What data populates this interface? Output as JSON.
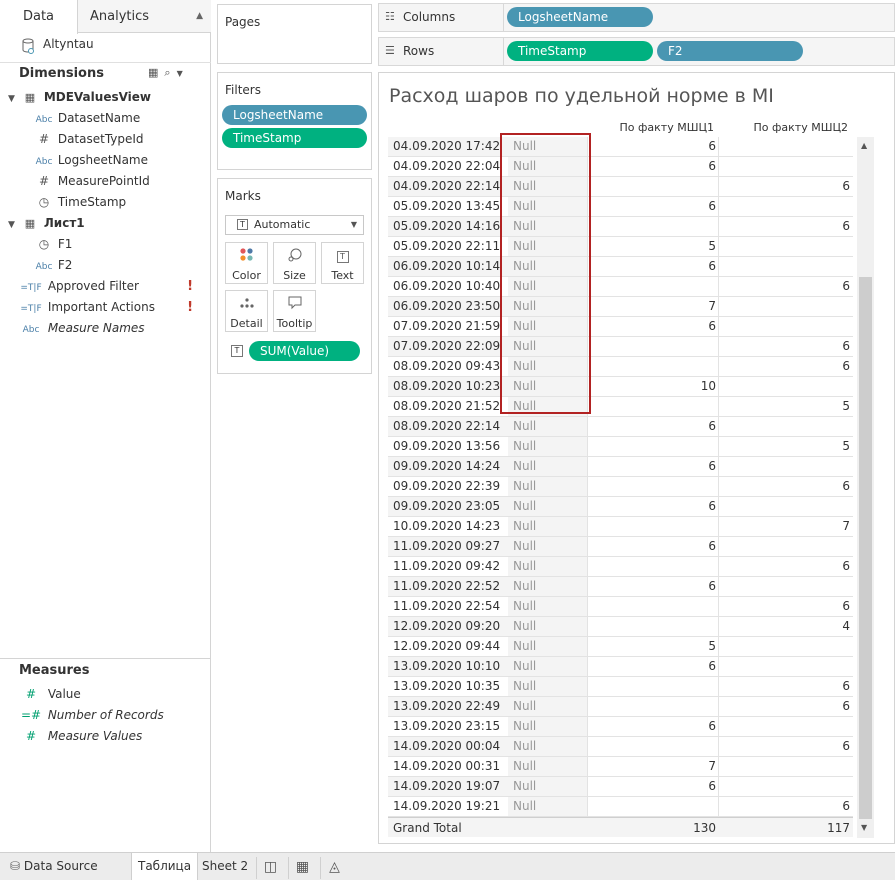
{
  "left_pane": {
    "tab_data": "Data",
    "tab_analytics": "Analytics",
    "datasource": "Altyntau",
    "dimensions_title": "Dimensions",
    "dimension_fields": [
      {
        "label": "MDEValuesView",
        "type": "table",
        "icon_text": "▦"
      },
      {
        "label": "DatasetName",
        "type": "string",
        "icon_text": "Abc"
      },
      {
        "label": "DatasetTypeId",
        "type": "number",
        "icon_text": "#"
      },
      {
        "label": "LogsheetName",
        "type": "string",
        "icon_text": "Abc"
      },
      {
        "label": "MeasurePointId",
        "type": "number",
        "icon_text": "#"
      },
      {
        "label": "TimeStamp",
        "type": "datetime",
        "icon_text": "◷"
      },
      {
        "label": "Лист1",
        "type": "table",
        "icon_text": "▦"
      },
      {
        "label": "F1",
        "type": "datetime",
        "icon_text": "◷"
      },
      {
        "label": "F2",
        "type": "string",
        "icon_text": "Abc"
      },
      {
        "label": "Approved Filter",
        "type": "boolean",
        "icon_text": "=T|F"
      },
      {
        "label": "Important Actions",
        "type": "boolean",
        "icon_text": "=T|F"
      },
      {
        "label": "Measure Names",
        "type": "string",
        "icon_text": "Abc"
      }
    ],
    "measures_title": "Measures",
    "measure_fields": [
      {
        "label": "Value",
        "icon_text": "#"
      },
      {
        "label": "Number of Records",
        "icon_text": "=#"
      },
      {
        "label": "Measure Values",
        "icon_text": "#"
      }
    ],
    "warning_mark": "!"
  },
  "cards": {
    "pages_title": "Pages",
    "filters_title": "Filters",
    "filters": [
      "LogsheetName",
      "TimeStamp"
    ],
    "marks_title": "Marks",
    "marks_type": "Automatic",
    "marks_buttons": [
      {
        "label": "Color",
        "icon": "color-icon"
      },
      {
        "label": "Size",
        "icon": "size-icon"
      },
      {
        "label": "Text",
        "icon": "text-icon"
      },
      {
        "label": "Detail",
        "icon": "detail-icon"
      },
      {
        "label": "Tooltip",
        "icon": "tooltip-icon"
      }
    ],
    "marks_pill": "SUM(Value)",
    "t_glyph": "T"
  },
  "shelves": {
    "columns_label": "Columns",
    "columns_pills": [
      "LogsheetName"
    ],
    "rows_label": "Rows",
    "rows_pills": [
      "TimeStamp",
      "F2"
    ]
  },
  "view": {
    "title": "Расход шаров по удельной норме в MI",
    "col_headers": [
      "По факту МШЦ1",
      "По факту МШЦ2"
    ],
    "null_label": "Null",
    "rows": [
      {
        "ts": "04.09.2020 17:42",
        "v1": "6",
        "v2": ""
      },
      {
        "ts": "04.09.2020 22:04",
        "v1": "6",
        "v2": ""
      },
      {
        "ts": "04.09.2020 22:14",
        "v1": "",
        "v2": "6"
      },
      {
        "ts": "05.09.2020 13:45",
        "v1": "6",
        "v2": ""
      },
      {
        "ts": "05.09.2020 14:16",
        "v1": "",
        "v2": "6"
      },
      {
        "ts": "05.09.2020 22:11",
        "v1": "5",
        "v2": ""
      },
      {
        "ts": "06.09.2020 10:14",
        "v1": "6",
        "v2": ""
      },
      {
        "ts": "06.09.2020 10:40",
        "v1": "",
        "v2": "6"
      },
      {
        "ts": "06.09.2020 23:50",
        "v1": "7",
        "v2": ""
      },
      {
        "ts": "07.09.2020 21:59",
        "v1": "6",
        "v2": ""
      },
      {
        "ts": "07.09.2020 22:09",
        "v1": "",
        "v2": "6"
      },
      {
        "ts": "08.09.2020 09:43",
        "v1": "",
        "v2": "6"
      },
      {
        "ts": "08.09.2020 10:23",
        "v1": "10",
        "v2": ""
      },
      {
        "ts": "08.09.2020 21:52",
        "v1": "",
        "v2": "5"
      },
      {
        "ts": "08.09.2020 22:14",
        "v1": "6",
        "v2": ""
      },
      {
        "ts": "09.09.2020 13:56",
        "v1": "",
        "v2": "5"
      },
      {
        "ts": "09.09.2020 14:24",
        "v1": "6",
        "v2": ""
      },
      {
        "ts": "09.09.2020 22:39",
        "v1": "",
        "v2": "6"
      },
      {
        "ts": "09.09.2020 23:05",
        "v1": "6",
        "v2": ""
      },
      {
        "ts": "10.09.2020 14:23",
        "v1": "",
        "v2": "7"
      },
      {
        "ts": "11.09.2020 09:27",
        "v1": "6",
        "v2": ""
      },
      {
        "ts": "11.09.2020 09:42",
        "v1": "",
        "v2": "6"
      },
      {
        "ts": "11.09.2020 22:52",
        "v1": "6",
        "v2": ""
      },
      {
        "ts": "11.09.2020 22:54",
        "v1": "",
        "v2": "6"
      },
      {
        "ts": "12.09.2020 09:20",
        "v1": "",
        "v2": "4"
      },
      {
        "ts": "12.09.2020 09:44",
        "v1": "5",
        "v2": ""
      },
      {
        "ts": "13.09.2020 10:10",
        "v1": "6",
        "v2": ""
      },
      {
        "ts": "13.09.2020 10:35",
        "v1": "",
        "v2": "6"
      },
      {
        "ts": "13.09.2020 22:49",
        "v1": "",
        "v2": "6"
      },
      {
        "ts": "13.09.2020 23:15",
        "v1": "6",
        "v2": ""
      },
      {
        "ts": "14.09.2020 00:04",
        "v1": "",
        "v2": "6"
      },
      {
        "ts": "14.09.2020 00:31",
        "v1": "7",
        "v2": ""
      },
      {
        "ts": "14.09.2020 19:07",
        "v1": "6",
        "v2": ""
      },
      {
        "ts": "14.09.2020 19:21",
        "v1": "",
        "v2": "6"
      }
    ],
    "grand_total": {
      "label": "Grand Total",
      "v1": "130",
      "v2": "117"
    },
    "highlight_color": "#b22222"
  },
  "bottom_tabs": {
    "data_source": "Data Source",
    "sheets": [
      "Таблица",
      "Sheet 2"
    ],
    "active_sheet": "Таблица"
  },
  "colors": {
    "pill_blue": "#4996b2",
    "pill_green": "#00b180",
    "warning": "#c0392b"
  }
}
